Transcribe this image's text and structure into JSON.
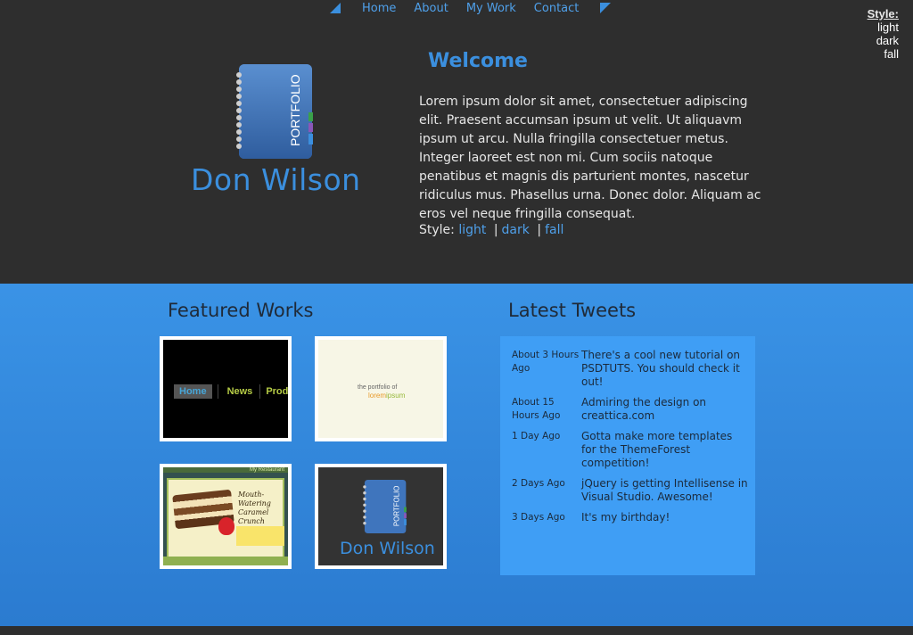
{
  "nav": {
    "items": [
      "Home",
      "About",
      "My Work",
      "Contact"
    ]
  },
  "style_switcher": {
    "title": "Style:",
    "options": [
      "light",
      "dark",
      "fall"
    ]
  },
  "header": {
    "logo_text": "PORTFOLIO",
    "site_name": "Don Wilson",
    "welcome": "Welcome",
    "intro": "Lorem ipsum dolor sit amet, consectetuer adipiscing elit. Praesent accumsan ipsum ut velit. Ut aliquavm ipsum ut arcu. Nulla fringilla consectetuer metus. Integer laoreet est non mi. Cum sociis natoque penatibus et magnis dis parturient montes, nascetur ridiculus mus. Phasellus urna. Donec dolor. Aliquam ac eros vel neque fringilla consequat.",
    "style_label": "Style:",
    "style_links": [
      "light",
      "dark",
      "fall"
    ],
    "style_separator": "|"
  },
  "featured": {
    "title": "Featured Works",
    "thumb1": {
      "nav": [
        "Home",
        "News",
        "Produ"
      ]
    },
    "thumb2": {
      "line1": "the portfolio of",
      "line2a": "lorem",
      "line2b": "ipsum"
    },
    "thumb3": {
      "top": "My Restaurant",
      "title": "Mouth-Watering Caramel Crunch"
    },
    "thumb4": {
      "logo_text": "PORTFOLIO",
      "name": "Don Wilson"
    }
  },
  "tweets": {
    "title": "Latest Tweets",
    "items": [
      {
        "time": "About 3 Hours Ago",
        "text": "There's a cool new tutorial on PSDTUTS. You should check it out!"
      },
      {
        "time": "About 15 Hours Ago",
        "text": "Admiring the design on creattica.com"
      },
      {
        "time": "1 Day Ago",
        "text": "Gotta make more templates for the ThemeForest competition!"
      },
      {
        "time": "2 Days Ago",
        "text": "jQuery is getting Intellisense in Visual Studio. Awesome!"
      },
      {
        "time": "3 Days Ago",
        "text": "It's my birthday!"
      }
    ]
  },
  "colors": {
    "accent": "#3b8fde",
    "header_bg": "#2e2e2e",
    "content_bg": "#3a93e6",
    "tweet_box": "#3f9ef5"
  }
}
